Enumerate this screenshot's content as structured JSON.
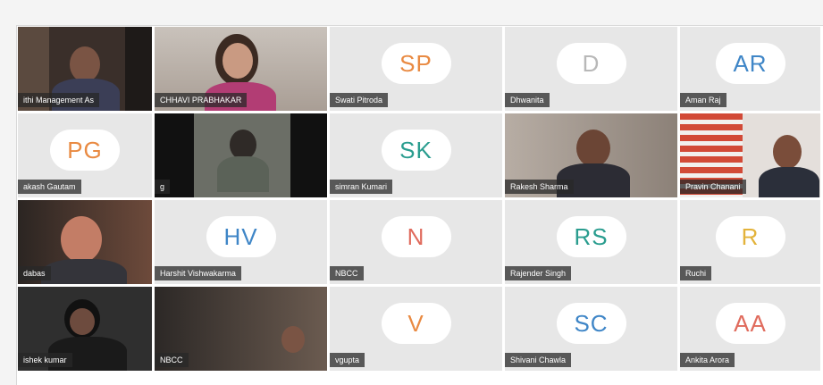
{
  "participants": [
    {
      "name": "ithi Management As",
      "initials": "",
      "color": "#000000"
    },
    {
      "name": "CHHAVI PRABHAKAR",
      "initials": "",
      "color": "#000000"
    },
    {
      "name": "Swati Pitroda",
      "initials": "SP",
      "color": "#e98a42"
    },
    {
      "name": "Dhwanita",
      "initials": "D",
      "color": "#b8b8b8"
    },
    {
      "name": "Aman Raj",
      "initials": "AR",
      "color": "#3f86c7"
    },
    {
      "name": "akash Gautam",
      "initials": "PG",
      "color": "#e98a42"
    },
    {
      "name": "g",
      "initials": "",
      "color": "#000000"
    },
    {
      "name": "simran Kumari",
      "initials": "SK",
      "color": "#2a9d8f"
    },
    {
      "name": "Rakesh Sharma",
      "initials": "",
      "color": "#000000"
    },
    {
      "name": "Pravin Chanani",
      "initials": "",
      "color": "#000000"
    },
    {
      "name": "dabas",
      "initials": "",
      "color": "#000000"
    },
    {
      "name": "Harshit Vishwakarma",
      "initials": "HV",
      "color": "#3f86c7"
    },
    {
      "name": "NBCC",
      "initials": "N",
      "color": "#e06b5d"
    },
    {
      "name": "Rajender Singh",
      "initials": "RS",
      "color": "#2a9d8f"
    },
    {
      "name": "Ruchi",
      "initials": "R",
      "color": "#e3b33b"
    },
    {
      "name": "ishek kumar",
      "initials": "",
      "color": "#000000"
    },
    {
      "name": "NBCC",
      "initials": "",
      "color": "#000000"
    },
    {
      "name": "vgupta",
      "initials": "V",
      "color": "#e98a42"
    },
    {
      "name": "Shivani Chawla",
      "initials": "SC",
      "color": "#3f86c7"
    },
    {
      "name": "Ankita Arora",
      "initials": "AA",
      "color": "#e06b5d"
    }
  ]
}
